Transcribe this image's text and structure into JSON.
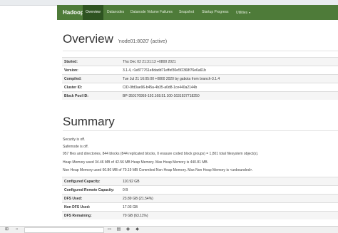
{
  "navbar": {
    "brand": "Hadoop",
    "items": [
      {
        "label": "Overview"
      },
      {
        "label": "Datanodes"
      },
      {
        "label": "Datanode Volume Failures"
      },
      {
        "label": "Snapshot"
      },
      {
        "label": "Startup Progress"
      },
      {
        "label": "Utilities"
      }
    ]
  },
  "overview": {
    "heading": "Overview",
    "subheading": "'node01:8020' (active)",
    "rows": [
      {
        "key": "Started:",
        "value": "Thu Dec 02 21:31:13 +0800 2021"
      },
      {
        "key": "Version:",
        "value": "3.1.4, r1e877761e8dadd71effef30e5f2368f76e6a61b"
      },
      {
        "key": "Compiled:",
        "value": "Tue Jul 21 16:05:00 +0800 2020 by gabota from branch-3.1.4"
      },
      {
        "key": "Cluster ID:",
        "value": "CID-9fd3ae96-b45a-4b35-a0d8-1ce440a2144b"
      },
      {
        "key": "Block Pool ID:",
        "value": "BP-350176959-192.168.51.100-1631937718250"
      }
    ]
  },
  "summary": {
    "heading": "Summary",
    "lines": [
      "Security is off.",
      "Safemode is off.",
      "957 files and directories, 844 blocks (844 replicated blocks, 0 erasure coded block groups) = 1,801 total filesystem object(s).",
      "Heap Memory used 34.46 MB of 42.56 MB Heap Memory. Max Heap Memory is 440.81 MB.",
      "Non Heap Memory used 60.86 MB of 70.19 MB Commited Non Heap Memory. Max Non Heap Memory is <unbounded>."
    ],
    "rows": [
      {
        "key": "Configured Capacity:",
        "value": "110.92 GB"
      },
      {
        "key": "Configured Remote Capacity:",
        "value": "0 B"
      },
      {
        "key": "DFS Used:",
        "value": "23.89 GB (21.54%)"
      },
      {
        "key": "Non DFS Used:",
        "value": "17.03 GB"
      },
      {
        "key": "DFS Remaining:",
        "value": "70 GB (63.11%)"
      }
    ]
  }
}
